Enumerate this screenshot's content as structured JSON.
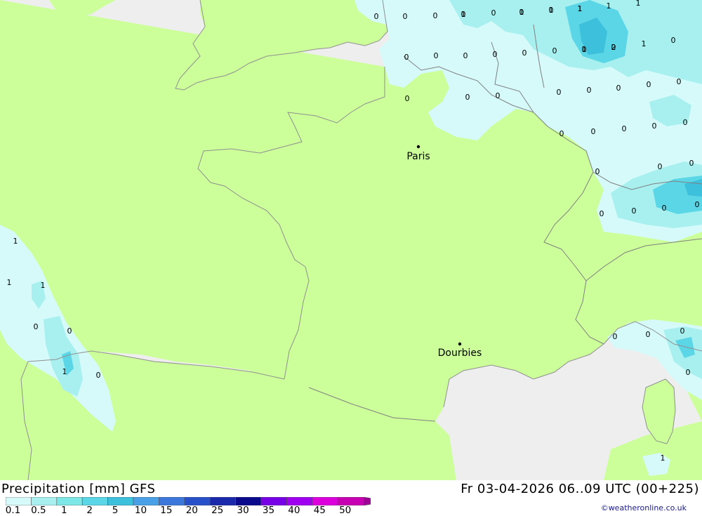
{
  "map": {
    "colors": {
      "sea": "#eeeeee",
      "land": "#ccff99",
      "coast": "#909090",
      "border": "#808080",
      "precip_0_1": "#d6fafa",
      "precip_0_5": "#a8f0f0",
      "precip_1": "#5ad6e6",
      "precip_2": "#3cc0dc"
    },
    "cities": [
      {
        "id": "paris",
        "name": "Paris"
      },
      {
        "id": "dourbies",
        "name": "Dourbies"
      }
    ],
    "precip_labels": [
      "0",
      "0",
      "0",
      "1",
      "0",
      "1",
      "1",
      "1",
      "1",
      "1",
      "0",
      "0",
      "0",
      "0",
      "0",
      "0",
      "1",
      "2",
      "1",
      "0",
      "0",
      "0",
      "0",
      "0",
      "0",
      "0",
      "0",
      "0",
      "0",
      "0",
      "0",
      "0",
      "0",
      "0",
      "0",
      "0",
      "0",
      "0",
      "0",
      "0",
      "1",
      "1",
      "1",
      "0",
      "0",
      "1",
      "0",
      "0",
      "0",
      "0",
      "0",
      "1",
      "0",
      "0",
      "0",
      "1",
      "0",
      "0"
    ]
  },
  "footer": {
    "title": "Precipitation [mm] GFS",
    "run_info": "Fr 03-04-2026 06..09 UTC (00+225)",
    "credit": "weatheronline.co.uk"
  },
  "legend": {
    "ticks": [
      "0.1",
      "0.5",
      "1",
      "2",
      "5",
      "10",
      "15",
      "20",
      "25",
      "30",
      "35",
      "40",
      "45",
      "50"
    ],
    "colors": [
      "#d6fafa",
      "#a8f0f0",
      "#7de6e6",
      "#5ad6e6",
      "#3cc0dc",
      "#4aa0e6",
      "#3c78dc",
      "#2850c8",
      "#1a28aa",
      "#0a0a8c",
      "#7800e6",
      "#a000f0",
      "#dc00dc",
      "#c800b4",
      "#a00096"
    ]
  }
}
